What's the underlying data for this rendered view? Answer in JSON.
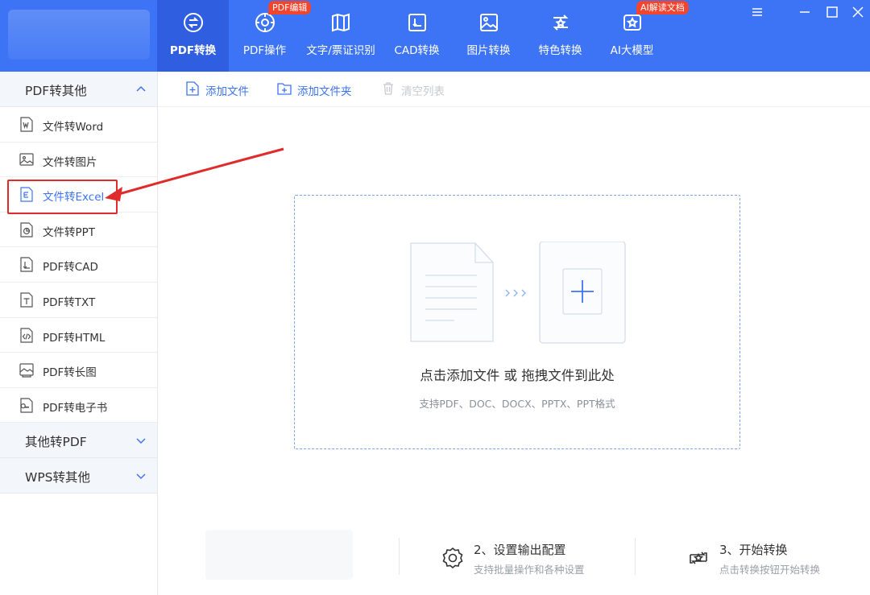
{
  "topnav": {
    "items": [
      {
        "label": "PDF转换",
        "icon": "pdf-convert-icon",
        "active": true
      },
      {
        "label": "PDF操作",
        "icon": "pdf-operate-icon",
        "badge": "PDF编辑"
      },
      {
        "label": "文字/票证识别",
        "icon": "ocr-scan-icon"
      },
      {
        "label": "CAD转换",
        "icon": "cad-convert-icon"
      },
      {
        "label": "图片转换",
        "icon": "image-convert-icon"
      },
      {
        "label": "特色转换",
        "icon": "special-convert-icon"
      },
      {
        "label": "AI大模型",
        "icon": "ai-model-icon",
        "badge": "AI解读文档"
      }
    ]
  },
  "colors": {
    "accent": "#3d74f5",
    "badge": "#f0452f",
    "highlight": "#e02b2b"
  },
  "sidebar": {
    "group1": {
      "title": "PDF转其他",
      "expanded": true
    },
    "items": [
      {
        "label": "文件转Word",
        "icon": "word-file-icon"
      },
      {
        "label": "文件转图片",
        "icon": "image-file-icon"
      },
      {
        "label": "文件转Excel",
        "icon": "excel-file-icon",
        "selected": true
      },
      {
        "label": "文件转PPT",
        "icon": "ppt-file-icon"
      },
      {
        "label": "PDF转CAD",
        "icon": "cad-file-icon"
      },
      {
        "label": "PDF转TXT",
        "icon": "txt-file-icon"
      },
      {
        "label": "PDF转HTML",
        "icon": "html-file-icon"
      },
      {
        "label": "PDF转长图",
        "icon": "long-image-icon"
      },
      {
        "label": "PDF转电子书",
        "icon": "ebook-file-icon"
      }
    ],
    "group2": {
      "title": "其他转PDF",
      "expanded": false
    },
    "group3": {
      "title": "WPS转其他",
      "expanded": false
    }
  },
  "toolbar": {
    "add_file": "添加文件",
    "add_folder": "添加文件夹",
    "clear_list": "清空列表"
  },
  "dropzone": {
    "main_text": "点击添加文件 或 拖拽文件到此处",
    "sub_text": "支持PDF、DOC、DOCX、PPTX、PPT格式"
  },
  "steps": [
    {
      "title": "2、设置输出配置",
      "desc": "支持批量操作和各种设置",
      "icon": "gear-icon"
    },
    {
      "title": "3、开始转换",
      "desc": "点击转换按钮开始转换",
      "icon": "convert-start-icon"
    }
  ]
}
